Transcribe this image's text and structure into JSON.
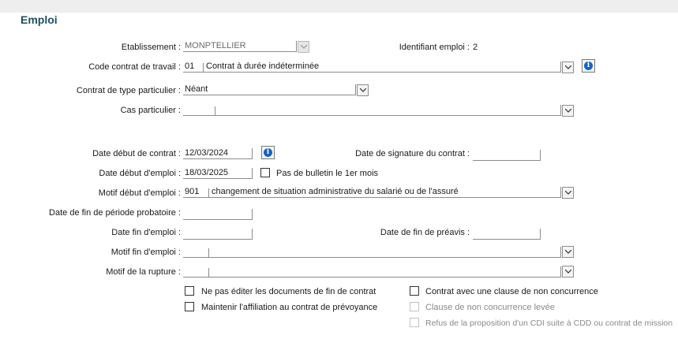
{
  "section": {
    "title": "Emploi"
  },
  "etablissement": {
    "label": "Etablissement :",
    "value": "MONPTELLIER"
  },
  "identifiant": {
    "label": "Identifiant emploi :",
    "value": "2"
  },
  "code_contrat": {
    "label": "Code contrat de travail :",
    "code": "01",
    "desc": "Contrat à durée indéterminée"
  },
  "contrat_particulier": {
    "label": "Contrat de type particulier :",
    "value": "Néant"
  },
  "cas_particulier": {
    "label": "Cas particulier :",
    "value": ""
  },
  "date_debut_contrat": {
    "label": "Date début de contrat :",
    "value": "12/03/2024"
  },
  "date_signature": {
    "label": "Date de signature du contrat :",
    "value": ""
  },
  "date_debut_emploi": {
    "label": "Date début d'emploi :",
    "value": "18/03/2025"
  },
  "pas_bulletin": {
    "label": "Pas de bulletin le 1er mois",
    "checked": false
  },
  "motif_debut": {
    "label": "Motif début d'emploi :",
    "code": "901",
    "desc": "changement de situation administrative du salarié ou de l'assuré"
  },
  "date_fin_probatoire": {
    "label": "Date de fin de période probatoire :",
    "value": ""
  },
  "date_fin_emploi": {
    "label": "Date fin d'emploi :",
    "value": ""
  },
  "date_fin_preavis": {
    "label": "Date de fin de préavis :",
    "value": ""
  },
  "motif_fin": {
    "label": "Motif fin d'emploi :",
    "value": ""
  },
  "motif_rupture": {
    "label": "Motif de la rupture :",
    "value": ""
  },
  "checkboxes": {
    "ne_pas_editer": {
      "label": "Ne pas éditer les documents de fin de contrat",
      "checked": false,
      "enabled": true
    },
    "maintenir_affiliation": {
      "label": "Maintenir l'affiliation au contrat de prévoyance",
      "checked": false,
      "enabled": true
    },
    "clause_non_concurrence": {
      "label": "Contrat avec une clause de non concurrence",
      "checked": false,
      "enabled": true
    },
    "clause_levee": {
      "label": "Clause de non concurrence levée",
      "checked": false,
      "enabled": false
    },
    "refus_cdi": {
      "label": "Refus de la proposition d'un CDI suite à CDD ou contrat de mission",
      "checked": false,
      "enabled": false
    }
  },
  "colors": {
    "title": "#1f4e63",
    "info": "#1565c0"
  }
}
